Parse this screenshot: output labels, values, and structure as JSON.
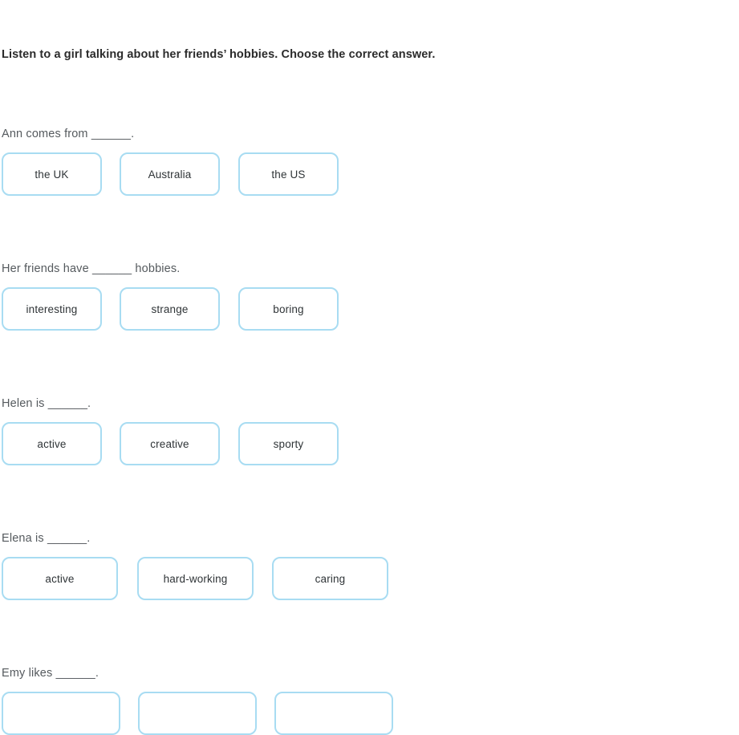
{
  "instruction": "Listen to a girl talking about her friends’ hobbies. Choose the correct answer.",
  "questions": [
    {
      "prompt": "Ann comes from ______.",
      "options": [
        "the UK",
        "Australia",
        "the US"
      ],
      "width_style": "narrow"
    },
    {
      "prompt": "Her friends have ______ hobbies.",
      "options": [
        "interesting",
        "strange",
        "boring"
      ],
      "width_style": "narrow"
    },
    {
      "prompt": "Helen is ______.",
      "options": [
        "active",
        "creative",
        "sporty"
      ],
      "width_style": "narrow"
    },
    {
      "prompt": "Elena is ______.",
      "options": [
        "active",
        "hard-working",
        "caring"
      ],
      "width_style": "wide"
    },
    {
      "prompt": "Emy likes ______.",
      "options": [
        "",
        "",
        ""
      ],
      "width_style": "widest"
    }
  ],
  "colors": {
    "option_border": "#a8dcf2",
    "option_background": "#ffffff",
    "instruction_text": "#2b2b2b",
    "prompt_text": "#555a5e",
    "option_text": "#2f3437",
    "page_background": "#ffffff"
  }
}
